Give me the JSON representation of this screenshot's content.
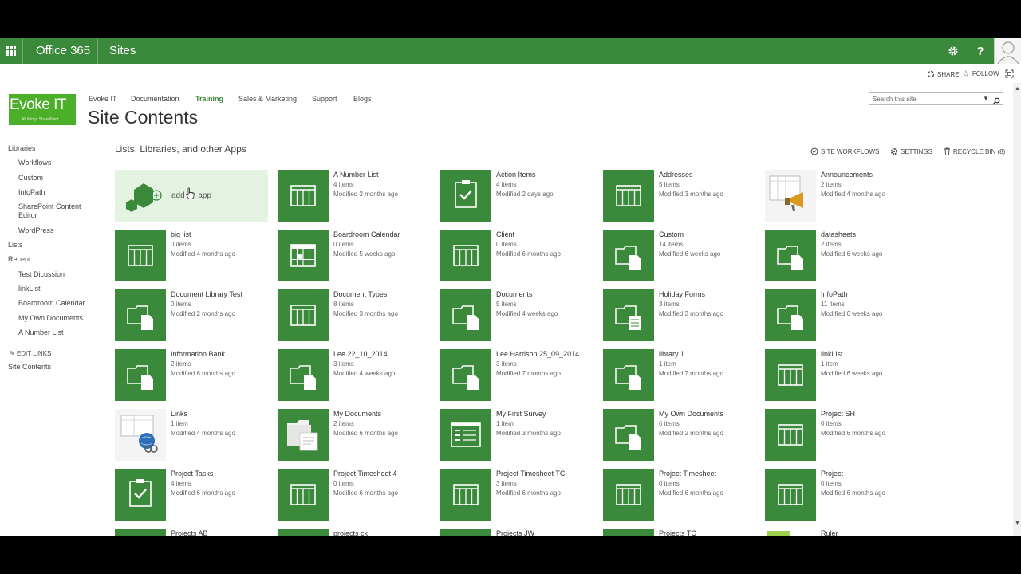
{
  "suite": {
    "brand": "Office 365",
    "section": "Sites",
    "help_label": "?"
  },
  "actions": {
    "share": "SHARE",
    "follow": "FOLLOW"
  },
  "logo": {
    "title": "Evoke IT",
    "subtitle": "All things SharePoint"
  },
  "topnav": [
    {
      "label": "Evoke IT",
      "active": false
    },
    {
      "label": "Documentation",
      "active": false
    },
    {
      "label": "Training",
      "active": true
    },
    {
      "label": "Sales & Marketing",
      "active": false
    },
    {
      "label": "Support",
      "active": false
    },
    {
      "label": "Blogs",
      "active": false
    }
  ],
  "page_title": "Site Contents",
  "search": {
    "placeholder": "Search this site"
  },
  "leftnav": [
    {
      "label": "Libraries",
      "sub": false
    },
    {
      "label": "Workflows",
      "sub": true
    },
    {
      "label": "Custom",
      "sub": true
    },
    {
      "label": "InfoPath",
      "sub": true
    },
    {
      "label": "SharePoint Content Editor",
      "sub": true
    },
    {
      "label": "WordPress",
      "sub": true
    },
    {
      "label": "Lists",
      "sub": false
    },
    {
      "label": "Recent",
      "sub": false
    },
    {
      "label": "Test Dicussion",
      "sub": true
    },
    {
      "label": "linkList",
      "sub": true
    },
    {
      "label": "Boardroom Calendar",
      "sub": true
    },
    {
      "label": "My Own Documents",
      "sub": true
    },
    {
      "label": "A Number List",
      "sub": true
    },
    {
      "label": "EDIT LINKS",
      "sub": false
    },
    {
      "label": "Site Contents",
      "sub": false
    }
  ],
  "section_title": "Lists, Libraries, and other Apps",
  "section_actions": {
    "workflows": "SITE WORKFLOWS",
    "settings": "SETTINGS",
    "recycle": "RECYCLE BIN (8)"
  },
  "add_app_label": "add an app",
  "tiles": [
    {
      "name": "A Number List",
      "count": "4 items",
      "modified": "Modified 2 months ago",
      "icon": "list-icon"
    },
    {
      "name": "Action Items",
      "count": "4 items",
      "modified": "Modified 2 days ago",
      "icon": "tasks-icon"
    },
    {
      "name": "Addresses",
      "count": "5 items",
      "modified": "Modified 3 months ago",
      "icon": "list-icon"
    },
    {
      "name": "Announcements",
      "count": "2 items",
      "modified": "Modified 4 months ago",
      "icon": "announcement-icon"
    },
    {
      "name": "big list",
      "count": "0 items",
      "modified": "Modified 4 months ago",
      "icon": "list-icon"
    },
    {
      "name": "Boardroom Calendar",
      "count": "0 items",
      "modified": "Modified 5 weeks ago",
      "icon": "calendar-icon"
    },
    {
      "name": "Client",
      "count": "0 items",
      "modified": "Modified 6 months ago",
      "icon": "list-icon"
    },
    {
      "name": "Custom",
      "count": "14 items",
      "modified": "Modified 6 weeks ago",
      "icon": "library-icon"
    },
    {
      "name": "datasheets",
      "count": "2 items",
      "modified": "Modified 6 weeks ago",
      "icon": "library-icon"
    },
    {
      "name": "Document Library Test",
      "count": "0 items",
      "modified": "Modified 2 months ago",
      "icon": "library-icon"
    },
    {
      "name": "Document Types",
      "count": "8 items",
      "modified": "Modified 3 months ago",
      "icon": "list-icon"
    },
    {
      "name": "Documents",
      "count": "5 items",
      "modified": "Modified 4 weeks ago",
      "icon": "library-icon"
    },
    {
      "name": "Holiday Forms",
      "count": "3 items",
      "modified": "Modified 3 months ago",
      "icon": "form-library-icon"
    },
    {
      "name": "InfoPath",
      "count": "11 items",
      "modified": "Modified 6 weeks ago",
      "icon": "library-icon"
    },
    {
      "name": "Information Bank",
      "count": "2 items",
      "modified": "Modified 6 months ago",
      "icon": "library-icon"
    },
    {
      "name": "Lee 22_10_2014",
      "count": "3 items",
      "modified": "Modified 4 weeks ago",
      "icon": "library-icon"
    },
    {
      "name": "Lee Harrison 25_09_2014",
      "count": "3 items",
      "modified": "Modified 7 months ago",
      "icon": "library-icon"
    },
    {
      "name": "library 1",
      "count": "1 item",
      "modified": "Modified 7 months ago",
      "icon": "library-icon"
    },
    {
      "name": "linkList",
      "count": "1 item",
      "modified": "Modified 6 weeks ago",
      "icon": "list-icon"
    },
    {
      "name": "Links",
      "count": "1 item",
      "modified": "Modified 4 months ago",
      "icon": "links-icon"
    },
    {
      "name": "My Documents",
      "count": "2 items",
      "modified": "Modified 6 months ago",
      "icon": "documents-icon"
    },
    {
      "name": "My First Survey",
      "count": "1 item",
      "modified": "Modified 3 months ago",
      "icon": "survey-icon"
    },
    {
      "name": "My Own Documents",
      "count": "6 items",
      "modified": "Modified 2 months ago",
      "icon": "library-icon"
    },
    {
      "name": "Project SH",
      "count": "0 items",
      "modified": "Modified 6 months ago",
      "icon": "list-icon"
    },
    {
      "name": "Project Tasks",
      "count": "4 items",
      "modified": "Modified 6 months ago",
      "icon": "tasks-icon"
    },
    {
      "name": "Project Timesheet 4",
      "count": "0 items",
      "modified": "Modified 6 months ago",
      "icon": "list-icon"
    },
    {
      "name": "Project Timesheet TC",
      "count": "3 items",
      "modified": "Modified 6 months ago",
      "icon": "list-icon"
    },
    {
      "name": "Project Timesheet",
      "count": "0 items",
      "modified": "Modified 6 months ago",
      "icon": "list-icon"
    },
    {
      "name": "Project",
      "count": "0 items",
      "modified": "Modified 6 months ago",
      "icon": "list-icon"
    },
    {
      "name": "Projects AB",
      "count": "",
      "modified": "",
      "icon": "list-icon"
    },
    {
      "name": "projects ck",
      "count": "",
      "modified": "",
      "icon": "list-icon"
    },
    {
      "name": "Projects JW",
      "count": "",
      "modified": "",
      "icon": "list-icon"
    },
    {
      "name": "Projects TC",
      "count": "",
      "modified": "",
      "icon": "list-icon"
    },
    {
      "name": "Ruler",
      "count": "",
      "modified": "",
      "icon": "ruler-icon"
    }
  ],
  "colors": {
    "accent": "#3b8a3b",
    "add_app_bg": "#e4f3e1",
    "logo": "#4caf2a"
  }
}
